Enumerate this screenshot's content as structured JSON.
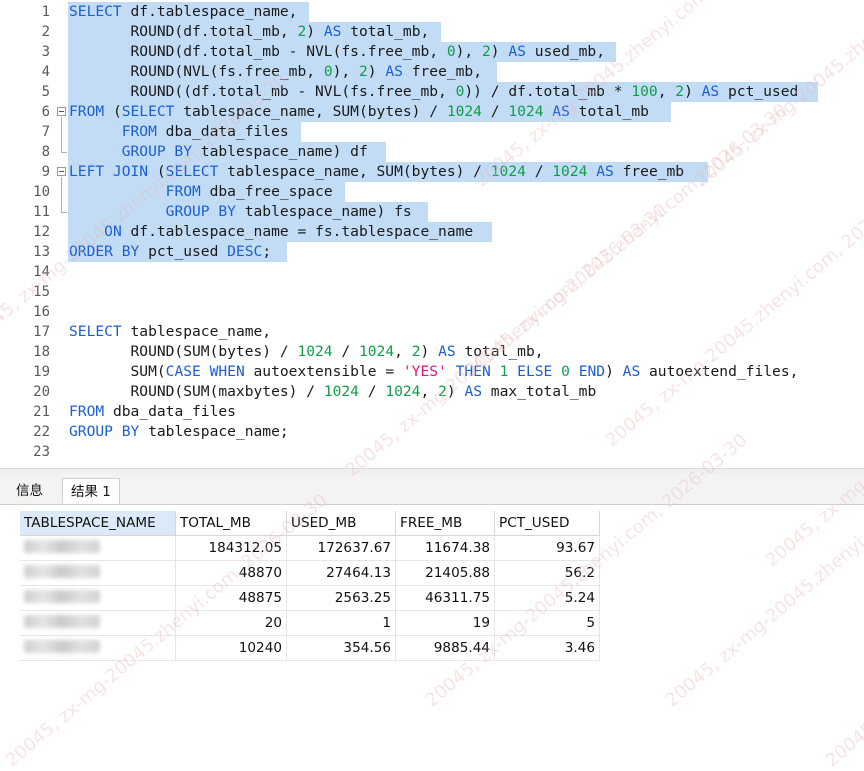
{
  "editor": {
    "line_numbers": [
      "1",
      "2",
      "3",
      "4",
      "5",
      "6",
      "7",
      "8",
      "9",
      "10",
      "11",
      "12",
      "13",
      "14",
      "15",
      "16",
      "17",
      "18",
      "19",
      "20",
      "21",
      "22",
      "23"
    ],
    "code": [
      [
        {
          "t": "SELECT",
          "c": "kw"
        },
        {
          "t": " df.tablespace_name,"
        }
      ],
      [
        {
          "t": "       ROUND(df.total_mb, "
        },
        {
          "t": "2",
          "c": "num"
        },
        {
          "t": ") "
        },
        {
          "t": "AS",
          "c": "kw"
        },
        {
          "t": " total_mb,"
        }
      ],
      [
        {
          "t": "       ROUND(df.total_mb - NVL(fs.free_mb, "
        },
        {
          "t": "0",
          "c": "num"
        },
        {
          "t": "), "
        },
        {
          "t": "2",
          "c": "num"
        },
        {
          "t": ") "
        },
        {
          "t": "AS",
          "c": "kw"
        },
        {
          "t": " used_mb,"
        }
      ],
      [
        {
          "t": "       ROUND(NVL(fs.free_mb, "
        },
        {
          "t": "0",
          "c": "num"
        },
        {
          "t": "), "
        },
        {
          "t": "2",
          "c": "num"
        },
        {
          "t": ") "
        },
        {
          "t": "AS",
          "c": "kw"
        },
        {
          "t": " free_mb,"
        }
      ],
      [
        {
          "t": "       ROUND((df.total_mb - NVL(fs.free_mb, "
        },
        {
          "t": "0",
          "c": "num"
        },
        {
          "t": ")) / df.total_mb * "
        },
        {
          "t": "100",
          "c": "num"
        },
        {
          "t": ", "
        },
        {
          "t": "2",
          "c": "num"
        },
        {
          "t": ") "
        },
        {
          "t": "AS",
          "c": "kw"
        },
        {
          "t": " pct_used"
        }
      ],
      [
        {
          "t": "FROM",
          "c": "kw"
        },
        {
          "t": " ("
        },
        {
          "t": "SELECT",
          "c": "kw"
        },
        {
          "t": " tablespace_name, SUM(bytes) / "
        },
        {
          "t": "1024",
          "c": "num"
        },
        {
          "t": " / "
        },
        {
          "t": "1024",
          "c": "num"
        },
        {
          "t": " "
        },
        {
          "t": "AS",
          "c": "kw"
        },
        {
          "t": " total_mb"
        }
      ],
      [
        {
          "t": "      "
        },
        {
          "t": "FROM",
          "c": "kw"
        },
        {
          "t": " dba_data_files"
        }
      ],
      [
        {
          "t": "      "
        },
        {
          "t": "GROUP BY",
          "c": "kw"
        },
        {
          "t": " tablespace_name) df"
        }
      ],
      [
        {
          "t": "LEFT JOIN",
          "c": "kw"
        },
        {
          "t": " ("
        },
        {
          "t": "SELECT",
          "c": "kw"
        },
        {
          "t": " tablespace_name, SUM(bytes) / "
        },
        {
          "t": "1024",
          "c": "num"
        },
        {
          "t": " / "
        },
        {
          "t": "1024",
          "c": "num"
        },
        {
          "t": " "
        },
        {
          "t": "AS",
          "c": "kw"
        },
        {
          "t": " free_mb"
        }
      ],
      [
        {
          "t": "           "
        },
        {
          "t": "FROM",
          "c": "kw"
        },
        {
          "t": " dba_free_space"
        }
      ],
      [
        {
          "t": "           "
        },
        {
          "t": "GROUP BY",
          "c": "kw"
        },
        {
          "t": " tablespace_name) fs"
        }
      ],
      [
        {
          "t": "    "
        },
        {
          "t": "ON",
          "c": "kw"
        },
        {
          "t": " df.tablespace_name = fs.tablespace_name"
        }
      ],
      [
        {
          "t": "ORDER BY",
          "c": "kw"
        },
        {
          "t": " pct_used "
        },
        {
          "t": "DESC",
          "c": "kw"
        },
        {
          "t": ";"
        }
      ],
      [],
      [],
      [],
      [
        {
          "t": "SELECT",
          "c": "kw"
        },
        {
          "t": " tablespace_name,"
        }
      ],
      [
        {
          "t": "       ROUND(SUM(bytes) / "
        },
        {
          "t": "1024",
          "c": "num"
        },
        {
          "t": " / "
        },
        {
          "t": "1024",
          "c": "num"
        },
        {
          "t": ", "
        },
        {
          "t": "2",
          "c": "num"
        },
        {
          "t": ") "
        },
        {
          "t": "AS",
          "c": "kw"
        },
        {
          "t": " total_mb,"
        }
      ],
      [
        {
          "t": "       SUM("
        },
        {
          "t": "CASE WHEN",
          "c": "kw"
        },
        {
          "t": " autoextensible = "
        },
        {
          "t": "'YES'",
          "c": "str"
        },
        {
          "t": " "
        },
        {
          "t": "THEN",
          "c": "kw"
        },
        {
          "t": " "
        },
        {
          "t": "1",
          "c": "num"
        },
        {
          "t": " "
        },
        {
          "t": "ELSE",
          "c": "kw"
        },
        {
          "t": " "
        },
        {
          "t": "0",
          "c": "num"
        },
        {
          "t": " "
        },
        {
          "t": "END",
          "c": "kw"
        },
        {
          "t": ") "
        },
        {
          "t": "AS",
          "c": "kw"
        },
        {
          "t": " autoextend_files,"
        }
      ],
      [
        {
          "t": "       ROUND(SUM(maxbytes) / "
        },
        {
          "t": "1024",
          "c": "num"
        },
        {
          "t": " / "
        },
        {
          "t": "1024",
          "c": "num"
        },
        {
          "t": ", "
        },
        {
          "t": "2",
          "c": "num"
        },
        {
          "t": ") "
        },
        {
          "t": "AS",
          "c": "kw"
        },
        {
          "t": " max_total_mb"
        }
      ],
      [
        {
          "t": "FROM",
          "c": "kw"
        },
        {
          "t": " dba_data_files"
        }
      ],
      [
        {
          "t": "GROUP BY",
          "c": "kw"
        },
        {
          "t": " tablespace_name;"
        }
      ],
      []
    ]
  },
  "tabs": {
    "info": "信息",
    "result": "结果 1"
  },
  "results": {
    "columns": [
      "TABLESPACE_NAME",
      "TOTAL_MB",
      "USED_MB",
      "FREE_MB",
      "PCT_USED"
    ],
    "rows": [
      [
        "",
        "184312.05",
        "172637.67",
        "11674.38",
        "93.67"
      ],
      [
        "",
        "48870",
        "27464.13",
        "21405.88",
        "56.2"
      ],
      [
        "",
        "48875",
        "2563.25",
        "46311.75",
        "5.24"
      ],
      [
        "",
        "20",
        "1",
        "19",
        "5"
      ],
      [
        "",
        "10240",
        "354.56",
        "9885.44",
        "3.46"
      ]
    ]
  },
  "watermark": "20045, zx-mg-20045.zhenyi.com, 2026-03-30",
  "colors": {
    "selection": "#c2dcf6",
    "keyword": "#1a5fd6",
    "number": "#0e9e4a",
    "string": "#e0157a"
  }
}
